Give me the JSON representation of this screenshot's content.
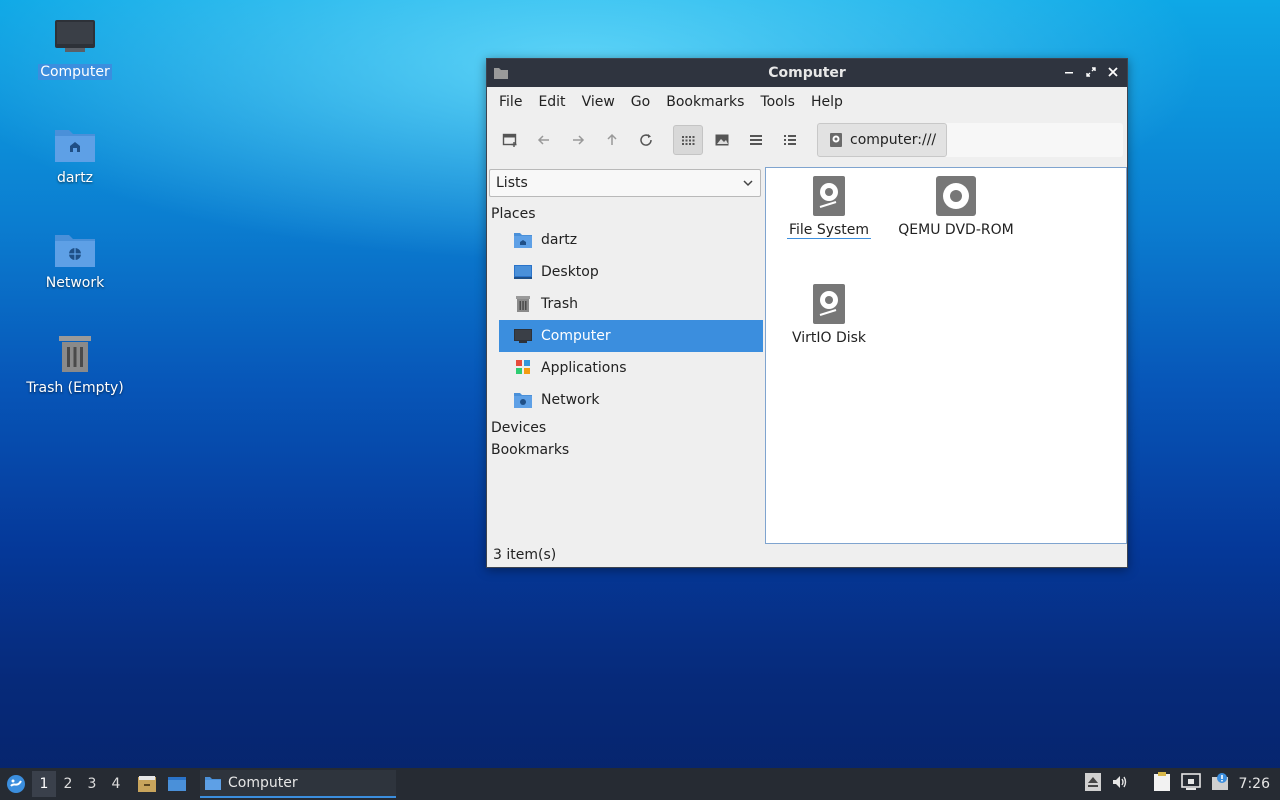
{
  "desktop": {
    "icons": [
      {
        "label": "Computer",
        "icon": "computer-icon"
      },
      {
        "label": "dartz",
        "icon": "home-folder-icon"
      },
      {
        "label": "Network",
        "icon": "network-folder-icon"
      },
      {
        "label": "Trash (Empty)",
        "icon": "trash-icon"
      }
    ]
  },
  "window": {
    "title": "Computer",
    "menu": [
      "File",
      "Edit",
      "View",
      "Go",
      "Bookmarks",
      "Tools",
      "Help"
    ],
    "path": "computer:///",
    "sidebar": {
      "mode": "Lists",
      "places_header": "Places",
      "places": [
        "dartz",
        "Desktop",
        "Trash",
        "Computer",
        "Applications",
        "Network"
      ],
      "devices_header": "Devices",
      "bookmarks_header": "Bookmarks"
    },
    "items": [
      "File System",
      "QEMU DVD-ROM",
      "VirtIO Disk"
    ],
    "status": "3 item(s)"
  },
  "taskbar": {
    "workspaces": [
      "1",
      "2",
      "3",
      "4"
    ],
    "task_label": "Computer",
    "clock": "7:26"
  },
  "colors": {
    "accent": "#3b8ede",
    "titlebar": "#2f343f",
    "taskbar": "#262b33"
  }
}
